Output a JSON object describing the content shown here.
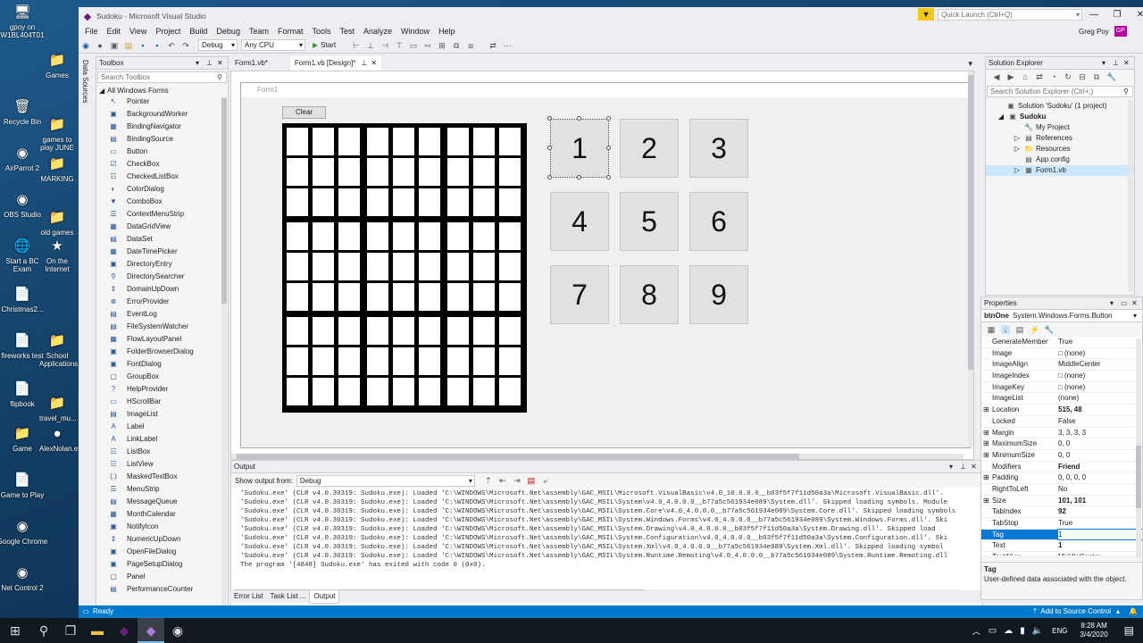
{
  "desktop": {
    "icons": [
      {
        "label": "gpoy on W1BL404T01",
        "glyph": "🖥"
      },
      {
        "label": "Games",
        "glyph": "📁"
      },
      {
        "label": "Recycle Bin",
        "glyph": "🗑"
      },
      {
        "label": "games to play JUNE",
        "glyph": "📁"
      },
      {
        "label": "AirParrot 2",
        "glyph": "◉"
      },
      {
        "label": "MARKING",
        "glyph": "📁"
      },
      {
        "label": "OBS Studio",
        "glyph": "◉"
      },
      {
        "label": "old games",
        "glyph": "📁"
      },
      {
        "label": "Start a BC Exam",
        "glyph": "🌐"
      },
      {
        "label": "On the Internet",
        "glyph": "★"
      },
      {
        "label": "Christmas2...",
        "glyph": "📄"
      },
      {
        "label": "fireworks test",
        "glyph": "📄"
      },
      {
        "label": "School Applications",
        "glyph": "📁"
      },
      {
        "label": "flipbook",
        "glyph": "📄"
      },
      {
        "label": "travel_mu...",
        "glyph": "📁"
      },
      {
        "label": "Game",
        "glyph": "📁"
      },
      {
        "label": "AlexNolan.exe",
        "glyph": "●"
      },
      {
        "label": "Game to Play",
        "glyph": "📄"
      },
      {
        "label": "Google Chrome",
        "glyph": "◉"
      },
      {
        "label": "Net Control 2",
        "glyph": "◉"
      }
    ]
  },
  "window": {
    "title": "Sudoku - Microsoft Visual Studio",
    "quick_launch_placeholder": "Quick Launch (Ctrl+Q)",
    "user": "Greg Poy",
    "user_initials": "GP",
    "accent": "#007acc"
  },
  "menu": [
    "File",
    "Edit",
    "View",
    "Project",
    "Build",
    "Debug",
    "Team",
    "Format",
    "Tools",
    "Test",
    "Analyze",
    "Window",
    "Help"
  ],
  "toolbar": {
    "config": "Debug",
    "platform": "Any CPU",
    "start_label": "Start"
  },
  "side_strip_label": "Data Sources",
  "toolbox": {
    "title": "Toolbox",
    "search_placeholder": "Search Toolbox",
    "group": "All Windows Forms",
    "items": [
      {
        "label": "Pointer",
        "glyph": "↖"
      },
      {
        "label": "BackgroundWorker",
        "glyph": "▣"
      },
      {
        "label": "BindingNavigator",
        "glyph": "▦"
      },
      {
        "label": "BindingSource",
        "glyph": "▤"
      },
      {
        "label": "Button",
        "glyph": "▭"
      },
      {
        "label": "CheckBox",
        "glyph": "☑"
      },
      {
        "label": "CheckedListBox",
        "glyph": "☷"
      },
      {
        "label": "ColorDialog",
        "glyph": "◐"
      },
      {
        "label": "ComboBox",
        "glyph": "▼"
      },
      {
        "label": "ContextMenuStrip",
        "glyph": "☰"
      },
      {
        "label": "DataGridView",
        "glyph": "▦"
      },
      {
        "label": "DataSet",
        "glyph": "▤"
      },
      {
        "label": "DateTimePicker",
        "glyph": "▦"
      },
      {
        "label": "DirectoryEntry",
        "glyph": "▣"
      },
      {
        "label": "DirectorySearcher",
        "glyph": "⚲"
      },
      {
        "label": "DomainUpDown",
        "glyph": "⇕"
      },
      {
        "label": "ErrorProvider",
        "glyph": "⊗"
      },
      {
        "label": "EventLog",
        "glyph": "▤"
      },
      {
        "label": "FileSystemWatcher",
        "glyph": "▤"
      },
      {
        "label": "FlowLayoutPanel",
        "glyph": "▦"
      },
      {
        "label": "FolderBrowserDialog",
        "glyph": "▣"
      },
      {
        "label": "FontDialog",
        "glyph": "▣"
      },
      {
        "label": "GroupBox",
        "glyph": "▢"
      },
      {
        "label": "HelpProvider",
        "glyph": "?"
      },
      {
        "label": "HScrollBar",
        "glyph": "▭"
      },
      {
        "label": "ImageList",
        "glyph": "▤"
      },
      {
        "label": "Label",
        "glyph": "A"
      },
      {
        "label": "LinkLabel",
        "glyph": "A"
      },
      {
        "label": "ListBox",
        "glyph": "☷"
      },
      {
        "label": "ListView",
        "glyph": "☷"
      },
      {
        "label": "MaskedTextBox",
        "glyph": "(.)"
      },
      {
        "label": "MenuStrip",
        "glyph": "☰"
      },
      {
        "label": "MessageQueue",
        "glyph": "▤"
      },
      {
        "label": "MonthCalendar",
        "glyph": "▦"
      },
      {
        "label": "NotifyIcon",
        "glyph": "▣"
      },
      {
        "label": "NumericUpDown",
        "glyph": "⇕"
      },
      {
        "label": "OpenFileDialog",
        "glyph": "▣"
      },
      {
        "label": "PageSetupDialog",
        "glyph": "▣"
      },
      {
        "label": "Panel",
        "glyph": "▢"
      },
      {
        "label": "PerformanceCounter",
        "glyph": "▤"
      }
    ]
  },
  "tabs": [
    {
      "label": "Form1.vb*",
      "active": false
    },
    {
      "label": "Form1.vb [Design]*",
      "active": true
    }
  ],
  "form": {
    "title": "Form1",
    "clear_label": "Clear",
    "buttons": [
      "1",
      "2",
      "3",
      "4",
      "5",
      "6",
      "7",
      "8",
      "9"
    ]
  },
  "output": {
    "title": "Output",
    "show_from_label": "Show output from:",
    "source": "Debug",
    "lines": [
      "'Sudoku.exe' (CLR v4.0.30319: Sudoku.exe): Loaded 'C:\\WINDOWS\\Microsoft.Net\\assembly\\GAC_MSIL\\Microsoft.VisualBasic\\v4.0_10.0.0.0__b03f5f7f11d50a3a\\Microsoft.VisualBasic.dll'.",
      "'Sudoku.exe' (CLR v4.0.30319: Sudoku.exe): Loaded 'C:\\WINDOWS\\Microsoft.Net\\assembly\\GAC_MSIL\\System\\v4.0_4.0.0.0__b77a5c561934e089\\System.dll'. Skipped loading symbols. Module",
      "'Sudoku.exe' (CLR v4.0.30319: Sudoku.exe): Loaded 'C:\\WINDOWS\\Microsoft.Net\\assembly\\GAC_MSIL\\System.Core\\v4.0_4.0.0.0__b77a5c561934e089\\System.Core.dll'. Skipped loading symbols",
      "'Sudoku.exe' (CLR v4.0.30319: Sudoku.exe): Loaded 'C:\\WINDOWS\\Microsoft.Net\\assembly\\GAC_MSIL\\System.Windows.Forms\\v4.0_4.0.0.0__b77a5c561934e089\\System.Windows.Forms.dll'. Ski",
      "'Sudoku.exe' (CLR v4.0.30319: Sudoku.exe): Loaded 'C:\\WINDOWS\\Microsoft.Net\\assembly\\GAC_MSIL\\System.Drawing\\v4.0_4.0.0.0__b03f5f7f11d50a3a\\System.Drawing.dll'. Skipped load",
      "'Sudoku.exe' (CLR v4.0.30319: Sudoku.exe): Loaded 'C:\\WINDOWS\\Microsoft.Net\\assembly\\GAC_MSIL\\System.Configuration\\v4.0_4.0.0.0__b03f5f7f11d50a3a\\System.Configuration.dll'. Ski",
      "'Sudoku.exe' (CLR v4.0.30319: Sudoku.exe): Loaded 'C:\\WINDOWS\\Microsoft.Net\\assembly\\GAC_MSIL\\System.Xml\\v4.0_4.0.0.0__b77a5c561934e089\\System.Xml.dll'. Skipped loading symbol",
      "'Sudoku.exe' (CLR v4.0.30319: Sudoku.exe): Loaded 'C:\\WINDOWS\\Microsoft.Net\\assembly\\GAC_MSIL\\System.Runtime.Remoting\\v4.0_4.0.0.0__b77a5c561934e089\\System.Runtime.Remoting.dll",
      "The program '[4848] Sudoku.exe' has exited with code 0 (0x0)."
    ]
  },
  "bottom_tabs": [
    {
      "label": "Error List",
      "active": false
    },
    {
      "label": "Task List ...",
      "active": false
    },
    {
      "label": "Output",
      "active": true
    }
  ],
  "solution_explorer": {
    "title": "Solution Explorer",
    "search_placeholder": "Search Solution Explorer (Ctrl+;)",
    "items": [
      {
        "label": "Solution 'Sudoku' (1 project)",
        "glyph": "▣",
        "expander": ""
      },
      {
        "label": "Sudoku",
        "glyph": "▣",
        "expander": "◢"
      },
      {
        "label": "My Project",
        "glyph": "🔧",
        "expander": ""
      },
      {
        "label": "References",
        "glyph": "▤",
        "expander": "▷"
      },
      {
        "label": "Resources",
        "glyph": "📁",
        "expander": "▷"
      },
      {
        "label": "App.config",
        "glyph": "▤",
        "expander": ""
      },
      {
        "label": "Form1.vb",
        "glyph": "▦",
        "expander": "▷"
      }
    ]
  },
  "properties": {
    "title": "Properties",
    "object": "btnOne",
    "object_type": "System.Windows.Forms.Button",
    "rows": [
      {
        "name": "GenerateMember",
        "value": "True",
        "expander": "",
        "bold": false,
        "selected": false
      },
      {
        "name": "Image",
        "value": "□ (none)",
        "expander": "",
        "bold": false,
        "selected": false
      },
      {
        "name": "ImageAlign",
        "value": "MiddleCenter",
        "expander": "",
        "bold": false,
        "selected": false
      },
      {
        "name": "ImageIndex",
        "value": "□ (none)",
        "expander": "",
        "bold": false,
        "selected": false
      },
      {
        "name": "ImageKey",
        "value": "□ (none)",
        "expander": "",
        "bold": false,
        "selected": false
      },
      {
        "name": "ImageList",
        "value": "(none)",
        "expander": "",
        "bold": false,
        "selected": false
      },
      {
        "name": "Location",
        "value": "515, 48",
        "expander": "⊞",
        "bold": true,
        "selected": false
      },
      {
        "name": "Locked",
        "value": "False",
        "expander": "",
        "bold": false,
        "selected": false
      },
      {
        "name": "Margin",
        "value": "3, 3, 3, 3",
        "expander": "⊞",
        "bold": false,
        "selected": false
      },
      {
        "name": "MaximumSize",
        "value": "0, 0",
        "expander": "⊞",
        "bold": false,
        "selected": false
      },
      {
        "name": "MinimumSize",
        "value": "0, 0",
        "expander": "⊞",
        "bold": false,
        "selected": false
      },
      {
        "name": "Modifiers",
        "value": "Friend",
        "expander": "",
        "bold": true,
        "selected": false
      },
      {
        "name": "Padding",
        "value": "0, 0, 0, 0",
        "expander": "⊞",
        "bold": false,
        "selected": false
      },
      {
        "name": "RightToLeft",
        "value": "No",
        "expander": "",
        "bold": false,
        "selected": false
      },
      {
        "name": "Size",
        "value": "101, 101",
        "expander": "⊞",
        "bold": true,
        "selected": false
      },
      {
        "name": "TabIndex",
        "value": "92",
        "expander": "",
        "bold": true,
        "selected": false
      },
      {
        "name": "TabStop",
        "value": "True",
        "expander": "",
        "bold": false,
        "selected": false
      },
      {
        "name": "Tag",
        "value": "1",
        "expander": "",
        "bold": false,
        "selected": true
      },
      {
        "name": "Text",
        "value": "1",
        "expander": "",
        "bold": true,
        "selected": false
      },
      {
        "name": "TextAlign",
        "value": "MiddleCenter",
        "expander": "",
        "bold": false,
        "selected": false
      }
    ],
    "desc_title": "Tag",
    "desc_text": "User-defined data associated with the object."
  },
  "status": {
    "text": "Ready",
    "source_control": "Add to Source Control"
  },
  "taskbar": {
    "lang": "ENG",
    "time": "8:28 AM",
    "date": "3/4/2020"
  }
}
